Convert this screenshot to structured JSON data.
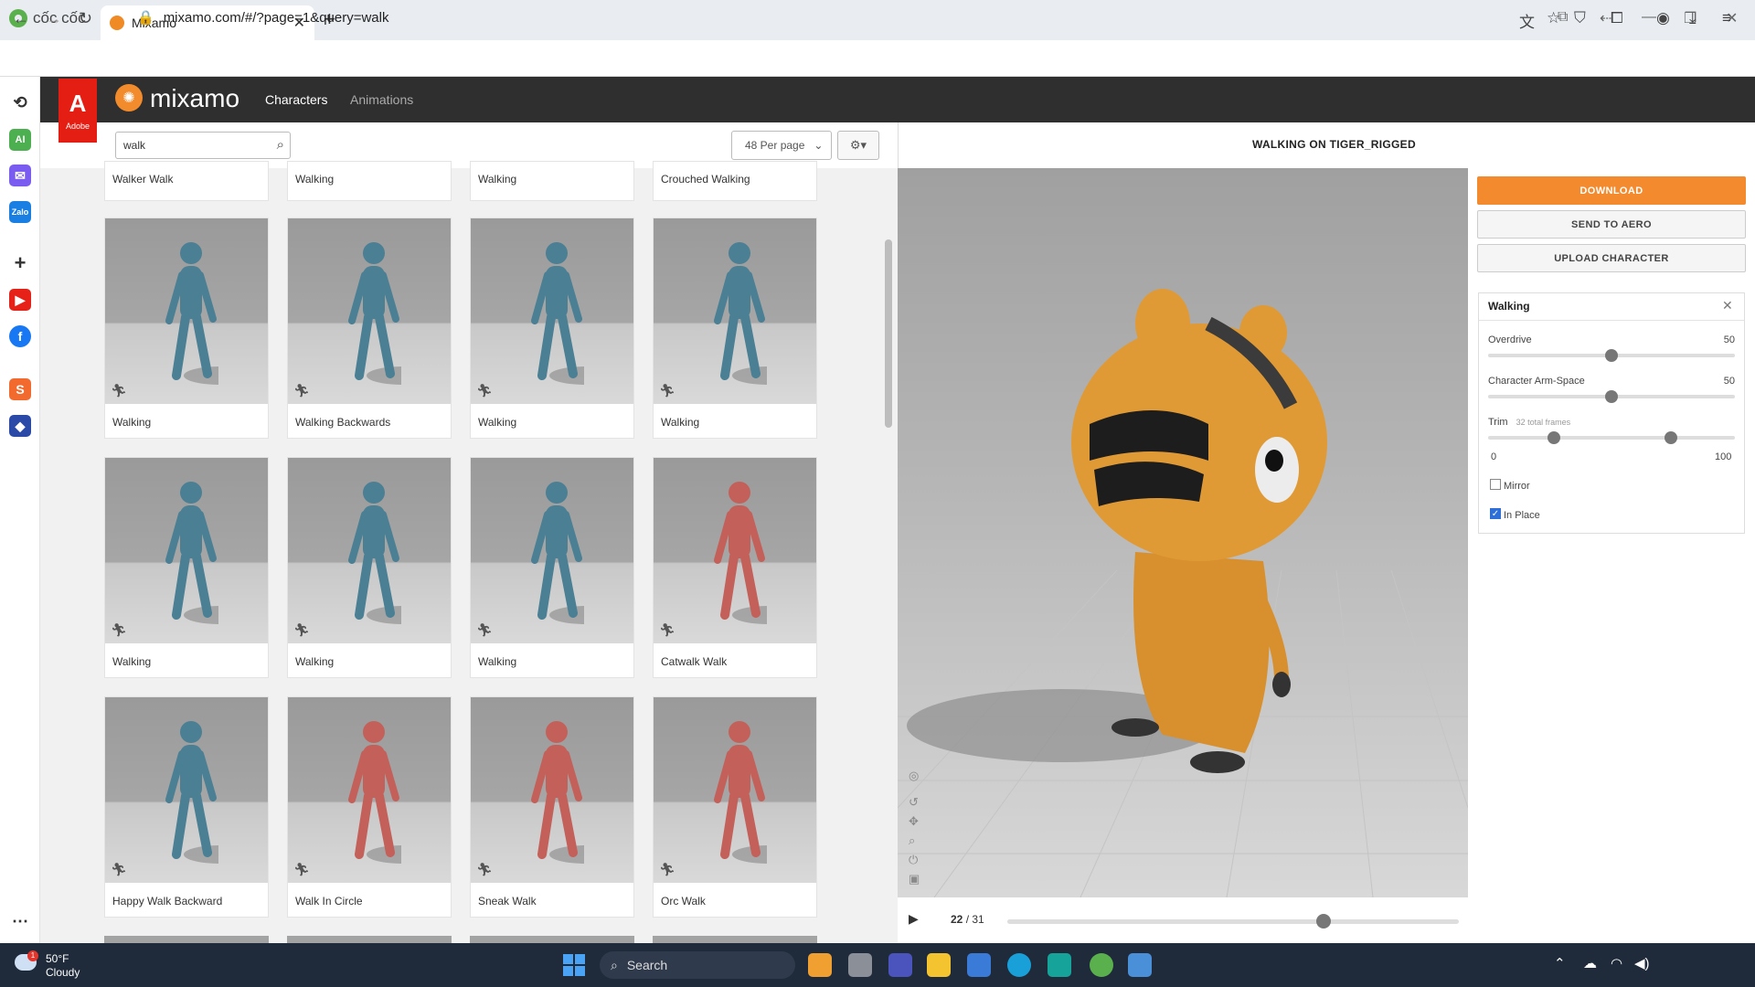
{
  "browser": {
    "brand": "cốc cốc",
    "tab_title": "Mixamo",
    "url": "mixamo.com/#/?page=1&query=walk"
  },
  "app": {
    "adobe_label": "Adobe",
    "logo_text": "mixamo",
    "nav": [
      "Characters",
      "Animations"
    ]
  },
  "toolbar": {
    "search_value": "walk",
    "per_page": "48 Per page"
  },
  "grid": {
    "top_partial": [
      "Walker Walk",
      "Walking",
      "Walking",
      "Crouched Walking"
    ],
    "cards": [
      {
        "label": "Walking",
        "color": "#4a7f94"
      },
      {
        "label": "Walking Backwards",
        "color": "#4a7f94"
      },
      {
        "label": "Walking",
        "color": "#4a7f94"
      },
      {
        "label": "Walking",
        "color": "#4a7f94"
      },
      {
        "label": "Walking",
        "color": "#4a7f94"
      },
      {
        "label": "Walking",
        "color": "#4a7f94"
      },
      {
        "label": "Walking",
        "color": "#4a7f94"
      },
      {
        "label": "Catwalk Walk",
        "color": "#c4605a"
      },
      {
        "label": "Happy Walk Backward",
        "color": "#4a7f94"
      },
      {
        "label": "Walk In Circle",
        "color": "#c4605a"
      },
      {
        "label": "Sneak Walk",
        "color": "#c4605a"
      },
      {
        "label": "Orc Walk",
        "color": "#c4605a"
      }
    ]
  },
  "viewer": {
    "title": "WALKING ON TIGER_RIGGED",
    "frame_current": "22",
    "frame_total": "31",
    "progress": 0.7
  },
  "panel": {
    "download": "DOWNLOAD",
    "send_to_aero": "SEND TO AERO",
    "upload_character": "UPLOAD CHARACTER",
    "settings_title": "Walking",
    "overdrive_label": "Overdrive",
    "overdrive_value": "50",
    "arm_label": "Character Arm-Space",
    "arm_value": "50",
    "trim_label": "Trim",
    "trim_note": "32 total frames",
    "trim_min": "0",
    "trim_max": "100",
    "mirror_label": "Mirror",
    "mirror_checked": false,
    "inplace_label": "In Place",
    "inplace_checked": true
  },
  "taskbar": {
    "temp": "50°F",
    "condition": "Cloudy",
    "badge": "1",
    "search": "Search"
  }
}
